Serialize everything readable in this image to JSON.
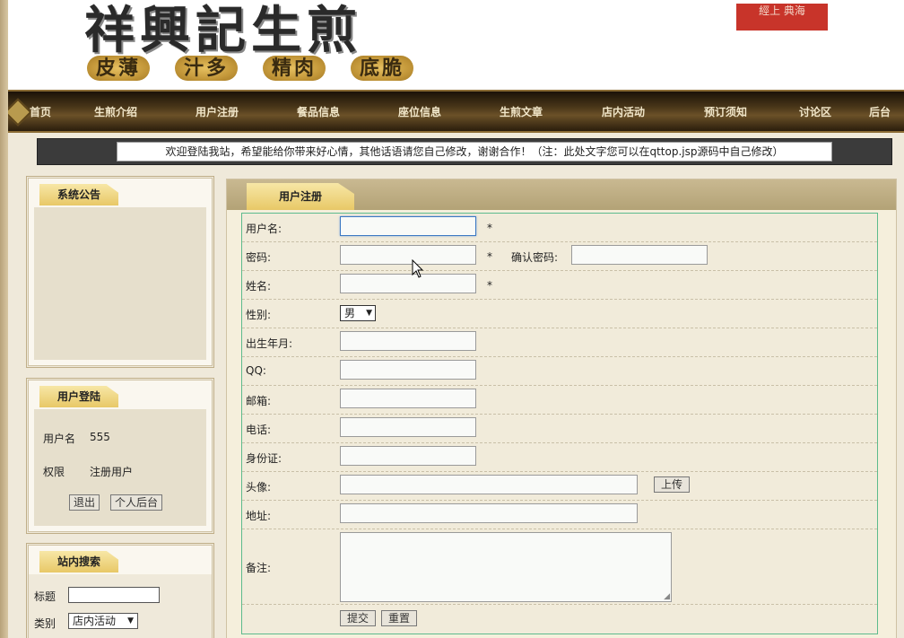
{
  "banner": {
    "title": "祥興記生煎",
    "tags": [
      "皮薄",
      "汁多",
      "精肉",
      "底脆"
    ],
    "seal": "經上 典海"
  },
  "nav": {
    "items": [
      "首页",
      "生煎介绍",
      "用户注册",
      "餐品信息",
      "座位信息",
      "生煎文章",
      "店内活动",
      "预订须知",
      "讨论区",
      "后台"
    ]
  },
  "notice": "欢迎登陆我站，希望能给你带来好心情，其他话语请您自己修改，谢谢合作！（注：此处文字您可以在qttop.jsp源码中自己修改）",
  "sidebar": {
    "announcement": {
      "title": "系统公告"
    },
    "login": {
      "title": "用户登陆",
      "username_label": "用户名",
      "username_value": "555",
      "role_label": "权限",
      "role_value": "注册用户",
      "logout_label": "退出",
      "backend_label": "个人后台"
    },
    "search": {
      "title": "站内搜索",
      "title_label": "标题",
      "title_value": "",
      "category_label": "类别",
      "category_value": "店内活动"
    }
  },
  "main": {
    "tab": "用户注册",
    "form": {
      "username_label": "用户名:",
      "password_label": "密码:",
      "confirm_label": "确认密码:",
      "name_label": "姓名:",
      "gender_label": "性别:",
      "gender_value": "男",
      "birth_label": "出生年月:",
      "qq_label": "QQ:",
      "email_label": "邮箱:",
      "phone_label": "电话:",
      "id_label": "身份证:",
      "avatar_label": "头像:",
      "upload_label": "上传",
      "address_label": "地址:",
      "remark_label": "备注:",
      "required_mark": "*",
      "submit_label": "提交",
      "reset_label": "重置"
    }
  },
  "colors": {
    "nav_text": "#f1e6c9",
    "form_border": "#5dbb8d",
    "tab_gold": "#e8c867"
  }
}
